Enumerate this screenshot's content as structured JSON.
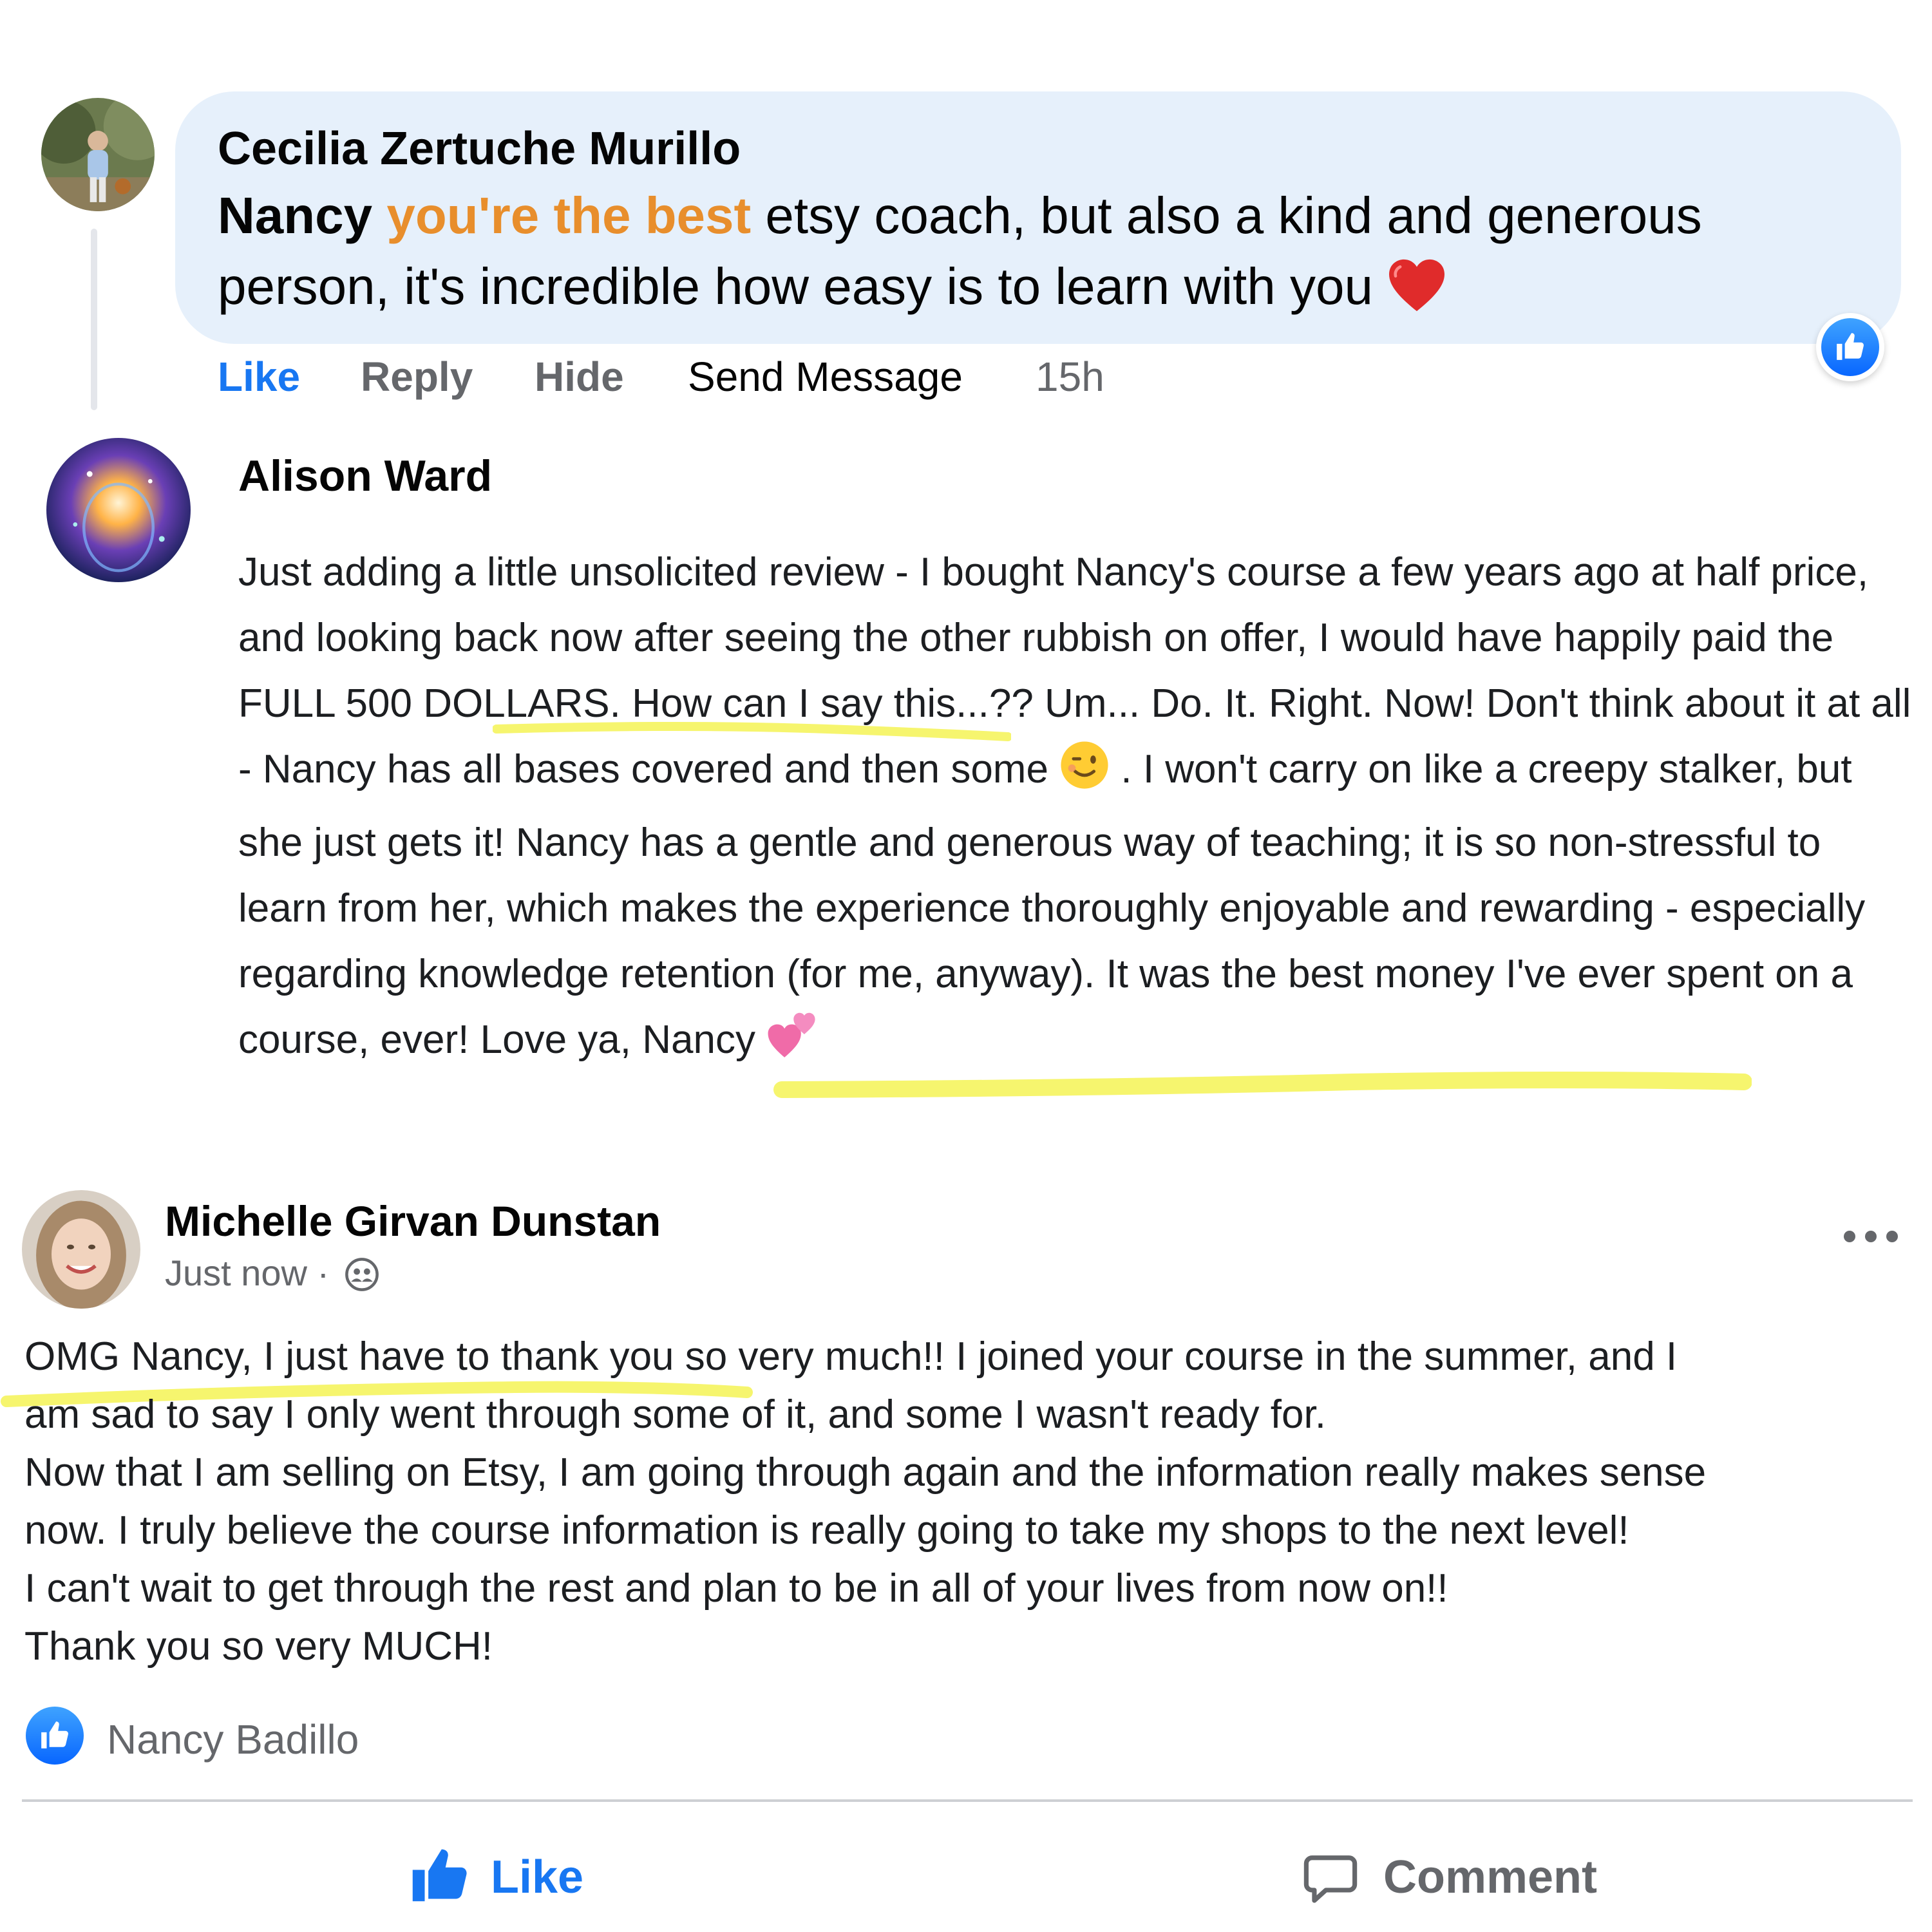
{
  "comment_1": {
    "author": "Cecilia Zertuche Murillo",
    "mention": "Nancy",
    "highlight": "you're the best",
    "text_rest": " etsy coach, but also a kind and generous person, it's incredible how easy is to learn with you ",
    "emoji": "red-heart-icon",
    "reaction": "like-icon",
    "actions": {
      "like": "Like",
      "reply": "Reply",
      "hide": "Hide",
      "send_message": "Send Message",
      "time": "15h"
    }
  },
  "comment_2": {
    "author": "Alison Ward",
    "text_part1": "Just adding a little unsolicited review - I bought Nancy's course a few years ago at half price, and looking back now after seeing the other rubbish on offer, I would have happily paid the FULL 500 DOLLARS. How can I say this...?? Um... Do. It. Right. Now! Don't think about it at all - Nancy has all bases covered and then some ",
    "text_part2": " . I won't carry on like a creepy stalker, but she just gets it! Nancy has a gentle and generous way of teaching; it is so non-stressful to learn from her, which makes the experience thoroughly enjoyable and rewarding - especially regarding knowledge retention (for me, anyway). It was the best money I've ever spent on a course, ever! Love ya, Nancy ",
    "emoji_1": "winking-face-icon",
    "emoji_2": "two-hearts-icon"
  },
  "post": {
    "author": "Michelle Girvan Dunstan",
    "time": "Just now · ",
    "audience_icon": "friends-icon",
    "lines": [
      "OMG Nancy, I just have to thank you so very much!! I joined your course in the summer, and I",
      "am sad to say I only went through some of it, and some I wasn't ready for.",
      "Now that I am selling on Etsy, I am going through again and the information really makes sense",
      "now. I truly believe the course information is really going to take my shops to the next level!",
      "I can't wait to get through the rest and plan to be in all of your lives from now on!!",
      "Thank you so very MUCH!"
    ],
    "reacted_by": "Nancy Badillo",
    "buttons": {
      "like": "Like",
      "comment": "Comment"
    }
  },
  "colors": {
    "facebook_blue": "#1877f2",
    "bubble_bg": "#e6f0fb",
    "highlight_orange": "#e88e2c",
    "marker_yellow": "#f6f56e",
    "muted_text": "#65676b"
  }
}
